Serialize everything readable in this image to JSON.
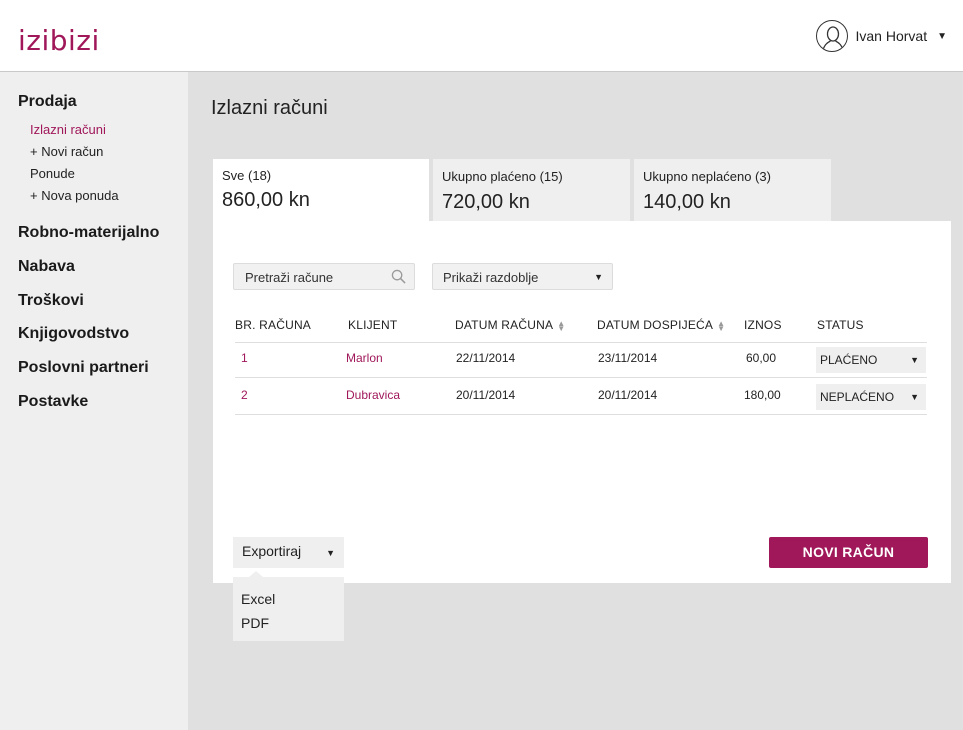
{
  "app": {
    "logo": "izibizi"
  },
  "user": {
    "name": "Ivan Horvat",
    "caret": "▼"
  },
  "sidebar": {
    "sections": [
      {
        "label": "Prodaja"
      },
      {
        "label": "Robno-materijalno"
      },
      {
        "label": "Nabava"
      },
      {
        "label": "Troškovi"
      },
      {
        "label": "Knjigovodstvo"
      },
      {
        "label": "Poslovni partneri"
      },
      {
        "label": "Postavke"
      }
    ],
    "sub_items": [
      {
        "label": "Izlazni računi",
        "active": true
      },
      {
        "label": "+ Novi račun"
      },
      {
        "label": "Ponude"
      },
      {
        "label": "+ Nova ponuda"
      }
    ]
  },
  "page": {
    "title": "Izlazni računi"
  },
  "tabs": [
    {
      "label": "Sve (18)",
      "amount": "860,00 kn",
      "active": true
    },
    {
      "label": "Ukupno plaćeno (15)",
      "amount": "720,00 kn"
    },
    {
      "label": "Ukupno neplaćeno (3)",
      "amount": "140,00 kn"
    }
  ],
  "filters": {
    "search_placeholder": "Pretraži račune",
    "period_label": "Prikaži razdoblje",
    "caret": "▼"
  },
  "table": {
    "columns": [
      "BR. RAČUNA",
      "KLIJENT",
      "DATUM RAČUNA",
      "DATUM DOSPIJEĆA",
      "IZNOS",
      "STATUS"
    ],
    "rows": [
      {
        "number": "1",
        "client": "Marlon",
        "date": "22/11/2014",
        "due": "23/11/2014",
        "amount": "60,00",
        "status": "PLAĆENO"
      },
      {
        "number": "2",
        "client": "Dubravica",
        "date": "20/11/2014",
        "due": "20/11/2014",
        "amount": "180,00",
        "status": "NEPLAĆENO"
      }
    ]
  },
  "actions": {
    "export_label": "Exportiraj",
    "new_invoice_label": "NOVI RAČUN",
    "export_options": [
      "Excel",
      "PDF"
    ]
  },
  "colors": {
    "accent": "#a0185a",
    "sidebar_bg": "#efefef",
    "main_bg": "#e0e0e0"
  },
  "icons": {
    "user": "avatar-icon",
    "search": "search-icon",
    "sort": "sort-icon"
  }
}
